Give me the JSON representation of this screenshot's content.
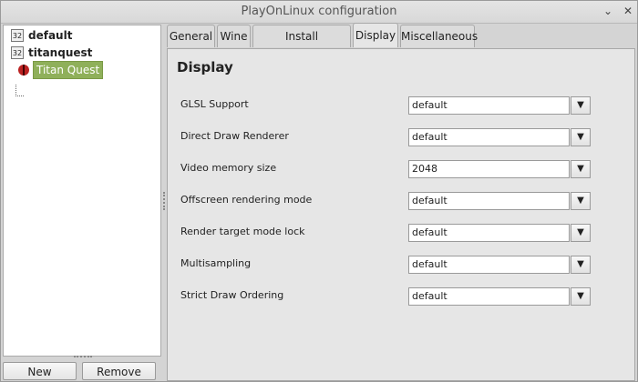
{
  "window": {
    "title": "PlayOnLinux configuration",
    "minimize": "⌄",
    "close": "✕"
  },
  "tree": {
    "items": [
      {
        "label": "default",
        "badge": "32"
      },
      {
        "label": "titanquest",
        "badge": "32"
      }
    ],
    "selected_child": "Titan Quest"
  },
  "buttons": {
    "new": "New",
    "remove": "Remove"
  },
  "tabs": [
    "General",
    "Wine",
    "Install components",
    "Display",
    "Miscellaneous"
  ],
  "panel": {
    "heading": "Display",
    "rows": [
      {
        "label": "GLSL Support",
        "value": "default"
      },
      {
        "label": "Direct Draw Renderer",
        "value": "default"
      },
      {
        "label": "Video memory size",
        "value": "2048"
      },
      {
        "label": "Offscreen rendering mode",
        "value": "default"
      },
      {
        "label": "Render target mode lock",
        "value": "default"
      },
      {
        "label": "Multisampling",
        "value": "default"
      },
      {
        "label": "Strict Draw Ordering",
        "value": "default"
      }
    ]
  }
}
